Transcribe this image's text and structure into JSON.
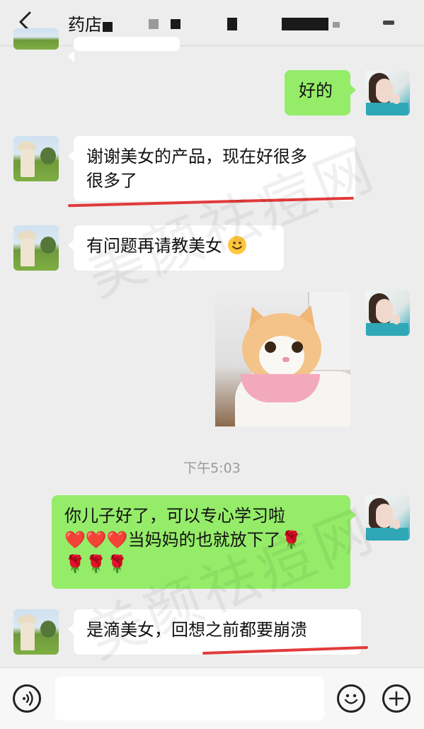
{
  "header": {
    "title": "药店",
    "back_icon": "chevron-left-icon",
    "more_icon": "more-icon"
  },
  "messages": [
    {
      "side": "right",
      "type": "text",
      "text": "好的"
    },
    {
      "side": "left",
      "type": "text",
      "lines": [
        "谢谢美女的产品，现在好很多",
        "很多了"
      ]
    },
    {
      "side": "left",
      "type": "text",
      "text": "有问题再请教美女",
      "emoji": "smiling-face-icon"
    },
    {
      "side": "right",
      "type": "image",
      "image": "cat-photo"
    },
    {
      "side": "right",
      "type": "text",
      "lines": [
        "你儿子好了，可以专心学习啦",
        "❤️❤️❤️当妈妈的也就放下了🌹",
        "🌹🌹🌹"
      ]
    },
    {
      "side": "left",
      "type": "text",
      "text": "是滴美女，回想之前都要崩溃"
    }
  ],
  "timestamp": "下午5:03",
  "watermark": "美颜祛痘网",
  "input": {
    "value": "",
    "voice_icon": "voice-icon",
    "emoji_icon": "emoji-icon",
    "plus_icon": "plus-icon"
  },
  "colors": {
    "background": "#ededed",
    "bubble_green": "#95ec69",
    "bubble_white": "#ffffff",
    "annotation_red": "#e23a3a"
  }
}
